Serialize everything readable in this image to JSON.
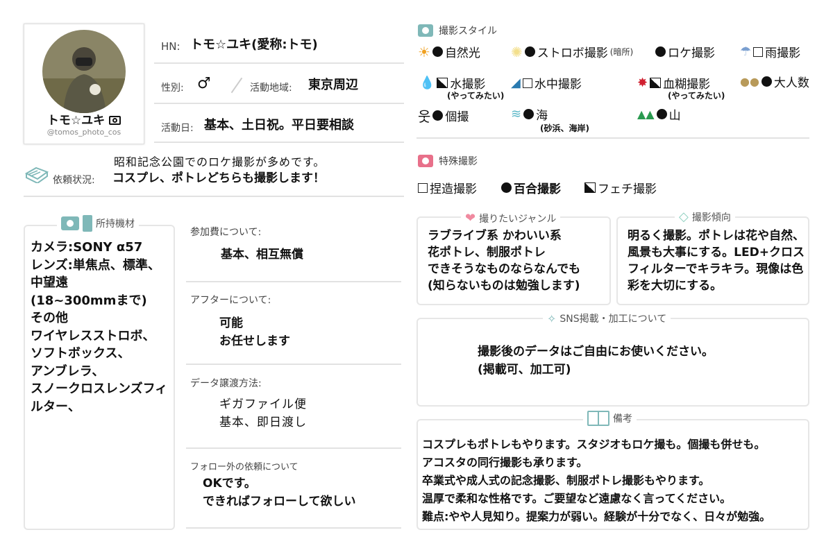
{
  "profile": {
    "name": "トモ☆ユキ",
    "handle": "@tomos_photo_cos",
    "hn_label": "HN:",
    "hn_value": "トモ☆ユキ(愛称:トモ)",
    "gender_label": "性別:",
    "gender_value": "♂",
    "area_label": "活動地域:",
    "area_value": "東京周辺",
    "days_label": "活動日:",
    "days_value": "基本、土日祝。平日要相談"
  },
  "request": {
    "label": "依頼状況:",
    "line1": "昭和記念公園でのロケ撮影が多めです。",
    "line2": "コスプレ、ポトレどちらも撮影します！"
  },
  "equipment": {
    "title": "所持機材",
    "lines": [
      "カメラ:SONY α57",
      "レンズ:単焦点、標準、",
      "中望遠",
      "(18~300mmまで)",
      "その他",
      "ワイヤレスストロボ、",
      "ソフトボックス、",
      "アンブレラ、",
      "スノークロスレンズフィ",
      "ルター、"
    ]
  },
  "fee": {
    "label": "参加費について:",
    "value": "基本、相互無償"
  },
  "after": {
    "label": "アフターについて:",
    "line1": "可能",
    "line2": "お任せします"
  },
  "delivery": {
    "label": "データ譲渡方法:",
    "line1": "ギガファイル便",
    "line2": "基本、即日渡し"
  },
  "follow": {
    "label": "フォロー外の依頼について",
    "line1": "OKです。",
    "line2": "できればフォローして欲しい"
  },
  "style": {
    "title": "撮影スタイル",
    "natural": "自然光",
    "strobe": "ストロボ撮影",
    "strobe_note": "(暗所)",
    "location": "ロケ撮影",
    "rain": "雨撮影",
    "water": "水撮影",
    "water_note": "(やってみたい)",
    "underwater": "水中撮影",
    "blood": "血糊撮影",
    "blood_note": "(やってみたい)",
    "group": "大人数",
    "solo": "個撮",
    "sea": "海",
    "sea_note": "(砂浜、海岸)",
    "mountain": "山"
  },
  "special": {
    "title": "特殊撮影",
    "fake": "捏造撮影",
    "yuri": "百合撮影",
    "fetish": "フェチ撮影"
  },
  "genre": {
    "title": "撮りたいジャンル",
    "lines": [
      "ラブライブ系 かわいい系",
      "花ポトレ、制服ポトレ",
      "できそうなものならなんでも",
      "(知らないものは勉強します)"
    ]
  },
  "tendency": {
    "title": "撮影傾向",
    "lines": [
      "明るく撮影。ポトレは花や自然、",
      "風景も大事にする。LED+クロス",
      "フィルターでキラキラ。現像は色",
      "彩を大切にする。"
    ]
  },
  "sns": {
    "title": "SNS掲載・加工について",
    "line1": "撮影後のデータはご自由にお使いください。",
    "line2": "(掲載可、加工可)"
  },
  "notes": {
    "title": "備考",
    "lines": [
      "コスプレもポトレもやります。スタジオもロケ撮も。個撮も併せも。",
      "アコスタの同行撮影も承ります。",
      "卒業式や成人式の記念撮影、制服ポトレ撮影もやります。",
      "温厚で柔和な性格です。ご要望など遠慮なく言ってください。",
      "難点:やや人見知り。提案力が弱い。経験が十分でなく、日々が勉強。"
    ]
  },
  "colors": {
    "accent_pink": "#e8708a",
    "accent_teal": "#7fb8b8",
    "icon_sun": "#f0a020",
    "icon_water": "#2a8ad0"
  }
}
